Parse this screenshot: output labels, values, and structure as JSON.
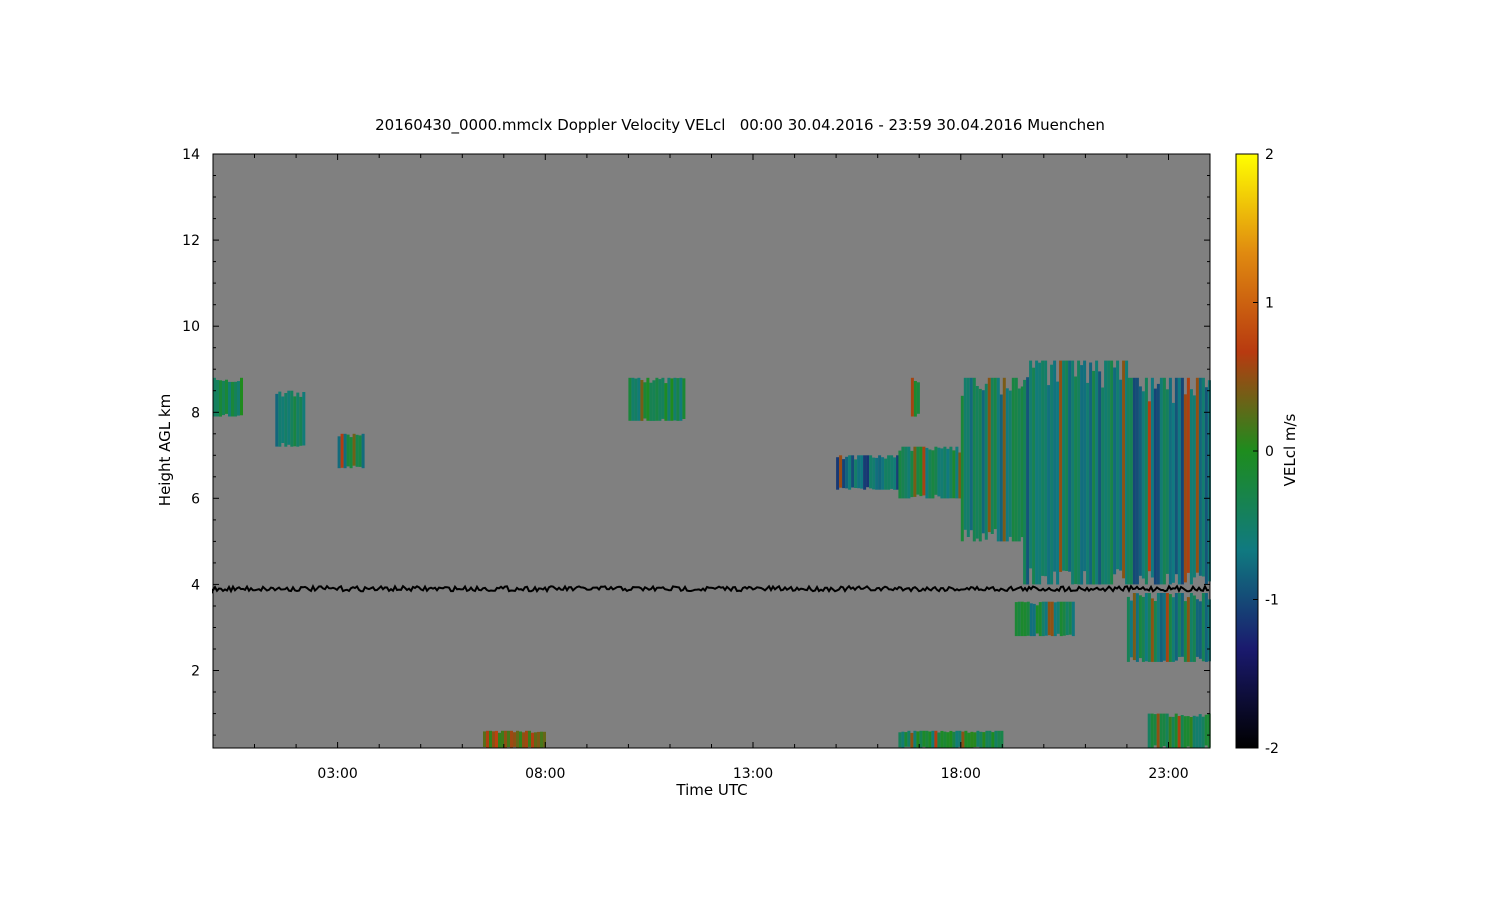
{
  "chart_data": {
    "type": "heatmap",
    "title": "20160430_0000.mmclx Doppler Velocity VELcl   00:00 30.04.2016 - 23:59 30.04.2016 Muenchen",
    "xlabel": "Time UTC",
    "ylabel": "Height AGL km",
    "colorbar_label": "VELcl m/s",
    "x_range_hours": [
      0,
      24
    ],
    "xticks": [
      {
        "value": 3,
        "label": "03:00"
      },
      {
        "value": 8,
        "label": "08:00"
      },
      {
        "value": 13,
        "label": "13:00"
      },
      {
        "value": 18,
        "label": "18:00"
      },
      {
        "value": 23,
        "label": "23:00"
      }
    ],
    "ylim": [
      0.2,
      14
    ],
    "yticks": [
      {
        "value": 2,
        "label": "2"
      },
      {
        "value": 4,
        "label": "4"
      },
      {
        "value": 6,
        "label": "6"
      },
      {
        "value": 8,
        "label": "8"
      },
      {
        "value": 10,
        "label": "10"
      },
      {
        "value": 12,
        "label": "12"
      },
      {
        "value": 14,
        "label": "14"
      }
    ],
    "colorbar_range": [
      -2,
      2
    ],
    "colorbar_ticks": [
      {
        "value": 2,
        "label": "2"
      },
      {
        "value": 1,
        "label": "1"
      },
      {
        "value": 0,
        "label": "0"
      },
      {
        "value": -1,
        "label": "-1"
      },
      {
        "value": -2,
        "label": "-2"
      }
    ],
    "colors": {
      "background": "#808080",
      "noise_line": "#000000",
      "colormap": [
        "#000000",
        "#1a1a6e",
        "#107a80",
        "#1e8c1e",
        "#b83a10",
        "#e08a10",
        "#ffff00"
      ]
    },
    "noise_band_height_km": 3.9,
    "regions": [
      {
        "t0": 0.0,
        "t1": 0.7,
        "h0": 7.9,
        "h1": 8.8,
        "v": -0.3
      },
      {
        "t0": 1.5,
        "t1": 2.2,
        "h0": 7.2,
        "h1": 8.5,
        "v": -0.5
      },
      {
        "t0": 3.0,
        "t1": 3.6,
        "h0": 6.7,
        "h1": 7.5,
        "v": -0.5
      },
      {
        "t0": 10.0,
        "t1": 11.3,
        "h0": 7.8,
        "h1": 8.8,
        "v": -0.3
      },
      {
        "t0": 16.8,
        "t1": 17.0,
        "h0": 7.9,
        "h1": 8.8,
        "v": -0.4
      },
      {
        "t0": 15.0,
        "t1": 16.5,
        "h0": 6.2,
        "h1": 7.0,
        "v": -0.8
      },
      {
        "t0": 16.5,
        "t1": 18.0,
        "h0": 6.0,
        "h1": 7.2,
        "v": -0.4
      },
      {
        "t0": 18.0,
        "t1": 19.5,
        "h0": 5.0,
        "h1": 8.8,
        "v": -0.5
      },
      {
        "t0": 19.5,
        "t1": 22.0,
        "h0": 4.0,
        "h1": 9.2,
        "v": -0.6
      },
      {
        "t0": 22.0,
        "t1": 24.0,
        "h0": 4.0,
        "h1": 8.8,
        "v": -0.7
      },
      {
        "t0": 19.3,
        "t1": 20.7,
        "h0": 2.8,
        "h1": 3.6,
        "v": -0.4
      },
      {
        "t0": 22.0,
        "t1": 24.0,
        "h0": 2.2,
        "h1": 3.8,
        "v": -0.5
      },
      {
        "t0": 6.5,
        "t1": 8.0,
        "h0": 0.2,
        "h1": 0.6,
        "v": 0.4
      },
      {
        "t0": 16.5,
        "t1": 19.0,
        "h0": 0.2,
        "h1": 0.6,
        "v": -0.3
      },
      {
        "t0": 22.5,
        "t1": 24.0,
        "h0": 0.2,
        "h1": 1.0,
        "v": -0.2
      }
    ]
  }
}
